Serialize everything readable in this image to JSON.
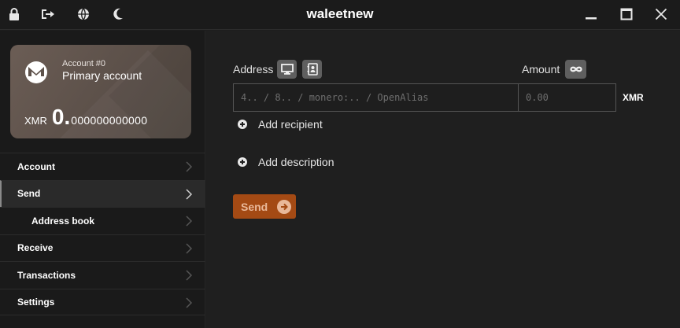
{
  "titlebar": {
    "title": "waleetnew",
    "left_icons": [
      "lock-icon",
      "logout-icon",
      "globe-icon",
      "moon-icon"
    ],
    "window_controls": [
      "minimize-icon",
      "maximize-icon",
      "close-icon"
    ]
  },
  "card": {
    "account_number": "Account #0",
    "account_name": "Primary account",
    "currency": "XMR",
    "balance_int": "0.",
    "balance_dec": "000000000000"
  },
  "menu": {
    "items": [
      {
        "label": "Account"
      },
      {
        "label": "Send"
      },
      {
        "label": "Address book"
      },
      {
        "label": "Receive"
      },
      {
        "label": "Transactions"
      },
      {
        "label": "Settings"
      }
    ]
  },
  "send": {
    "address_label": "Address",
    "amount_label": "Amount",
    "address_placeholder": "4.. / 8.. / monero:.. / OpenAlias",
    "amount_placeholder": "0.00",
    "unit": "XMR",
    "add_recipient": "Add recipient",
    "add_description": "Add description",
    "send_label": "Send"
  },
  "colors": {
    "accent": "#a44a14",
    "accent_text": "#e9b899",
    "background": "#1f1f1f"
  }
}
